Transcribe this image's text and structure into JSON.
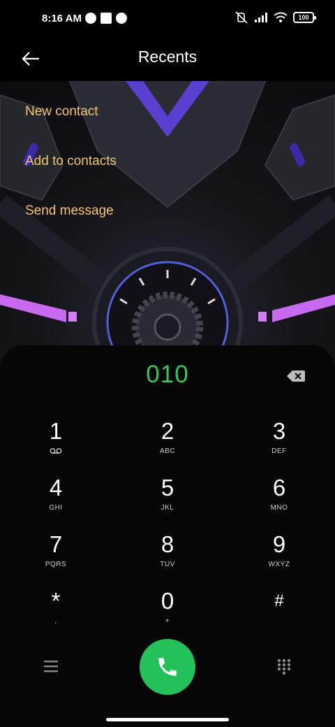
{
  "status_bar": {
    "time": "8:16 AM",
    "battery": "100"
  },
  "header": {
    "title": "Recents"
  },
  "menu": [
    {
      "label": "New contact"
    },
    {
      "label": "Add to contacts"
    },
    {
      "label": "Send message"
    }
  ],
  "dialer": {
    "number": "010",
    "keys": [
      [
        {
          "digit": "1",
          "letters": ""
        },
        {
          "digit": "2",
          "letters": "ABC"
        },
        {
          "digit": "3",
          "letters": "DEF"
        }
      ],
      [
        {
          "digit": "4",
          "letters": "GHI"
        },
        {
          "digit": "5",
          "letters": "JKL"
        },
        {
          "digit": "6",
          "letters": "MNO"
        }
      ],
      [
        {
          "digit": "7",
          "letters": "PQRS"
        },
        {
          "digit": "8",
          "letters": "TUV"
        },
        {
          "digit": "9",
          "letters": "WXYZ"
        }
      ],
      [
        {
          "digit": "*",
          "letters": ","
        },
        {
          "digit": "0",
          "letters": "+"
        },
        {
          "digit": "#",
          "letters": ""
        }
      ]
    ]
  },
  "colors": {
    "number": "#35c759",
    "menu_text": "#f3c66e",
    "call_button": "#23c15a"
  },
  "icons": [
    "back-arrow-icon",
    "backspace-icon",
    "voicemail-icon",
    "menu-icon",
    "phone-icon",
    "keypad-icon"
  ]
}
